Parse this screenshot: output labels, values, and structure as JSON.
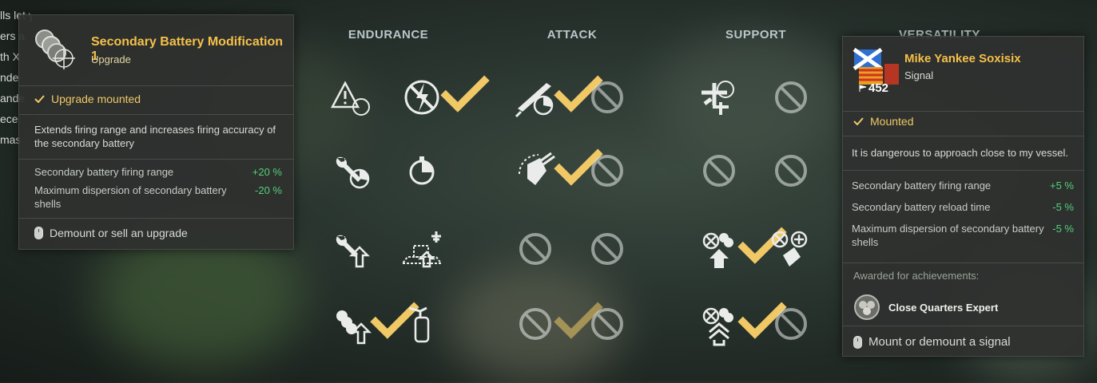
{
  "background_text": [
    "lls let you improve the",
    "ers a",
    "",
    "th X",
    "nde",
    "ande",
    "ece",
    "mas"
  ],
  "columns": [
    "ENDURANCE",
    "ATTACK",
    "SUPPORT",
    "VERSATILITY"
  ],
  "skills": [
    {
      "col": 0,
      "row": 0,
      "pos": 0,
      "icon": "warning-target-icon",
      "checked": false,
      "disabled": false
    },
    {
      "col": 0,
      "row": 0,
      "pos": 1,
      "icon": "no-lightning-icon",
      "checked": true,
      "disabled": false
    },
    {
      "col": 0,
      "row": 1,
      "pos": 0,
      "icon": "wrench-timer-icon",
      "checked": false,
      "disabled": false
    },
    {
      "col": 0,
      "row": 1,
      "pos": 1,
      "icon": "stopwatch-icon",
      "checked": false,
      "disabled": false
    },
    {
      "col": 0,
      "row": 2,
      "pos": 0,
      "icon": "wrench-upgrade-icon",
      "checked": false,
      "disabled": false
    },
    {
      "col": 0,
      "row": 2,
      "pos": 1,
      "icon": "ship-aircraft-icon",
      "checked": false,
      "disabled": false
    },
    {
      "col": 0,
      "row": 3,
      "pos": 0,
      "icon": "secondary-battery-upgrade-icon",
      "checked": true,
      "disabled": false
    },
    {
      "col": 0,
      "row": 3,
      "pos": 1,
      "icon": "extinguisher-icon",
      "checked": false,
      "disabled": false
    },
    {
      "col": 1,
      "row": 0,
      "pos": 0,
      "icon": "torpedo-timer-icon",
      "checked": true,
      "disabled": false
    },
    {
      "col": 1,
      "row": 0,
      "pos": 1,
      "icon": "disabled-slot-icon",
      "checked": false,
      "disabled": true
    },
    {
      "col": 1,
      "row": 1,
      "pos": 0,
      "icon": "gun-turret-icon",
      "checked": true,
      "disabled": false
    },
    {
      "col": 1,
      "row": 1,
      "pos": 1,
      "icon": "disabled-slot-icon",
      "checked": false,
      "disabled": true
    },
    {
      "col": 1,
      "row": 2,
      "pos": 0,
      "icon": "disabled-slot-icon",
      "checked": false,
      "disabled": true
    },
    {
      "col": 1,
      "row": 2,
      "pos": 1,
      "icon": "disabled-slot-icon",
      "checked": false,
      "disabled": true
    },
    {
      "col": 1,
      "row": 3,
      "pos": 0,
      "icon": "disabled-slot-icon",
      "checked": true,
      "disabled": true
    },
    {
      "col": 1,
      "row": 3,
      "pos": 1,
      "icon": "disabled-slot-icon",
      "checked": false,
      "disabled": true
    },
    {
      "col": 2,
      "row": 0,
      "pos": 0,
      "icon": "aircraft-target-icon",
      "checked": false,
      "disabled": false
    },
    {
      "col": 2,
      "row": 0,
      "pos": 1,
      "icon": "disabled-slot-icon",
      "checked": false,
      "disabled": true
    },
    {
      "col": 2,
      "row": 1,
      "pos": 0,
      "icon": "disabled-slot-icon",
      "checked": false,
      "disabled": true
    },
    {
      "col": 2,
      "row": 1,
      "pos": 1,
      "icon": "disabled-slot-icon",
      "checked": false,
      "disabled": true
    },
    {
      "col": 2,
      "row": 2,
      "pos": 0,
      "icon": "aa-secondary-upgrade-icon",
      "checked": true,
      "disabled": false
    },
    {
      "col": 2,
      "row": 2,
      "pos": 1,
      "icon": "aa-secondary-plus-icon",
      "checked": false,
      "disabled": false
    },
    {
      "col": 2,
      "row": 3,
      "pos": 0,
      "icon": "aa-secondary-double-upgrade-icon",
      "checked": true,
      "disabled": false
    },
    {
      "col": 2,
      "row": 3,
      "pos": 1,
      "icon": "disabled-slot-icon",
      "checked": false,
      "disabled": true
    }
  ],
  "tooltip_left": {
    "title": "Secondary Battery Modification 1",
    "subtitle": "Upgrade",
    "status": "Upgrade mounted",
    "description": "Extends firing range and increases firing accuracy of the secondary battery",
    "stats": [
      {
        "label": "Secondary battery firing range",
        "value": "+20 %"
      },
      {
        "label": "Maximum dispersion of secondary battery shells",
        "value": "-20 %"
      }
    ],
    "action": "Demount or sell an upgrade"
  },
  "tooltip_right": {
    "title": "Mike Yankee Soxisix",
    "subtitle": "Signal",
    "count": "452",
    "status": "Mounted",
    "description": "It is dangerous to approach close to my vessel.",
    "stats": [
      {
        "label": "Secondary battery firing range",
        "value": "+5 %"
      },
      {
        "label": "Secondary battery reload time",
        "value": "-5 %"
      },
      {
        "label": "Maximum dispersion of secondary battery shells",
        "value": "-5 %"
      }
    ],
    "awarded_label": "Awarded for achievements:",
    "achievement": "Close Quarters Expert",
    "action": "Mount or demount a signal"
  },
  "colors": {
    "accent": "#f5c04a",
    "positive": "#54d07a",
    "check": "#f0c866",
    "header": "#b9c6c9"
  }
}
